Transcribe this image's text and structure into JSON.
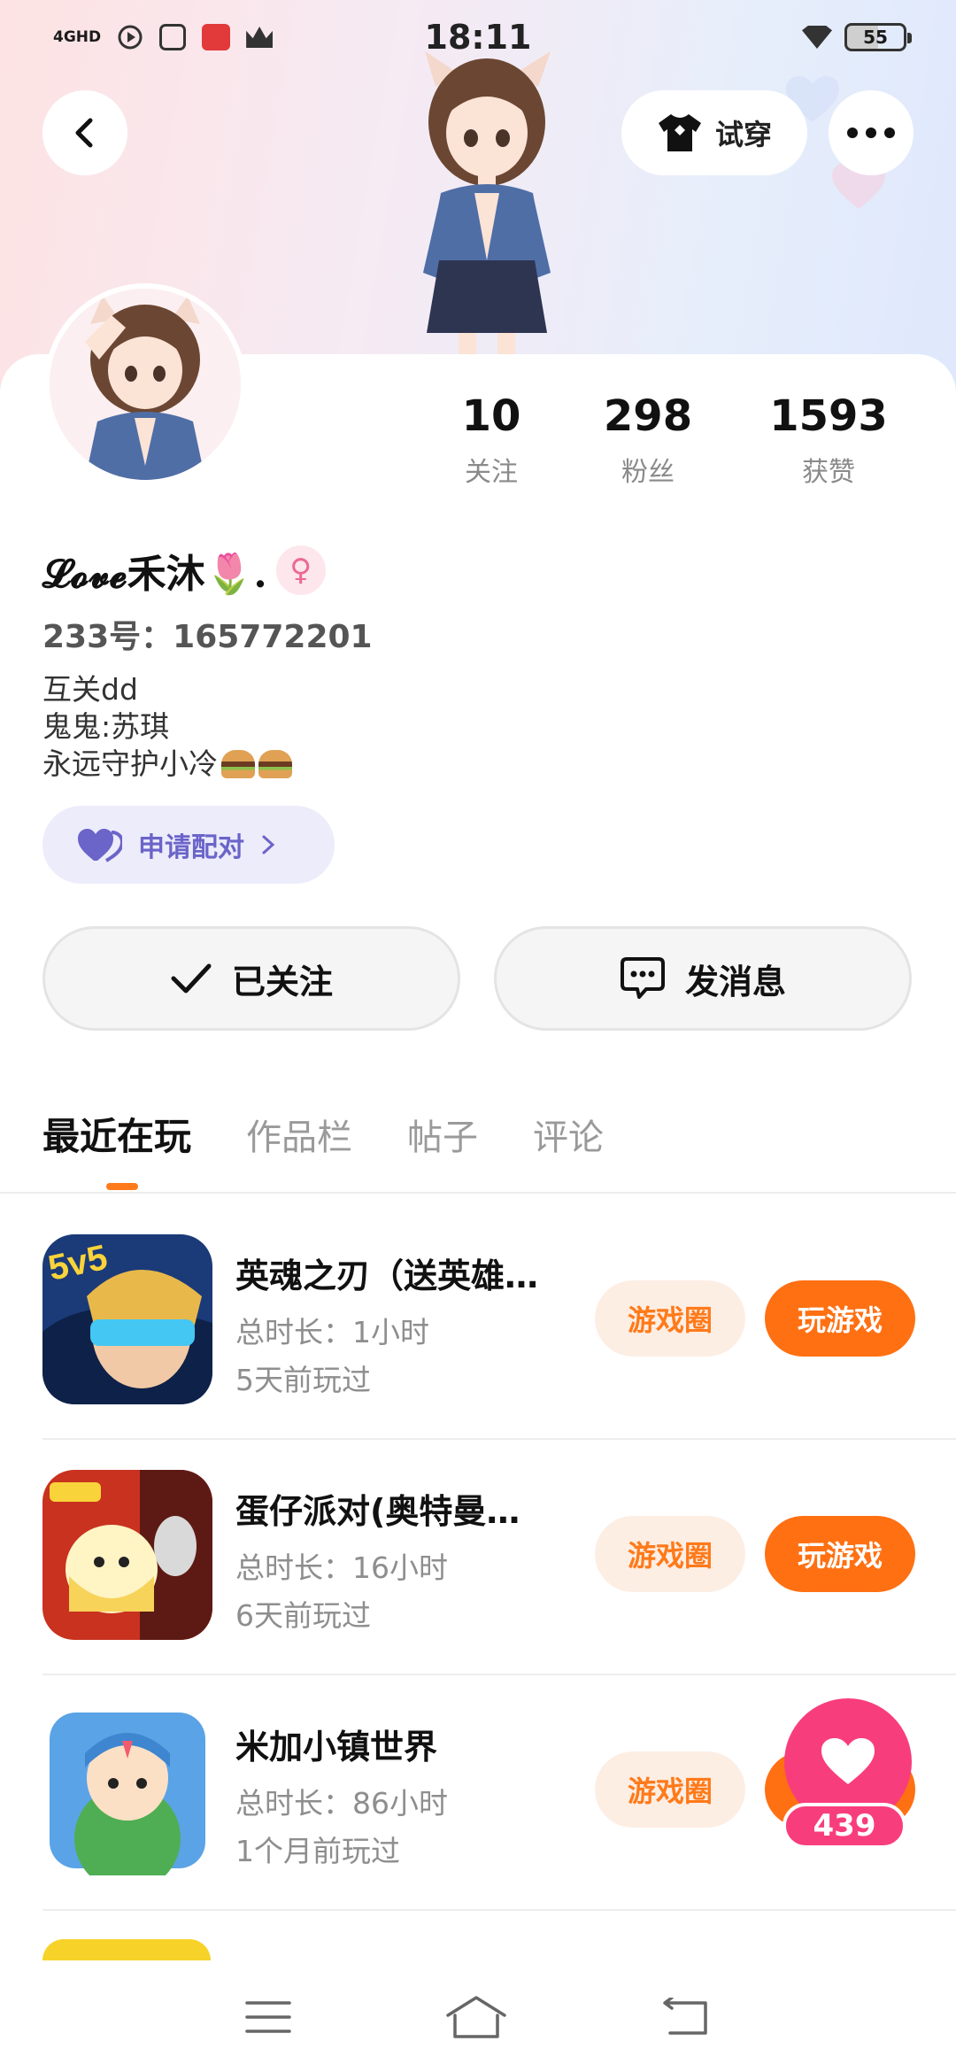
{
  "status_bar": {
    "network": "4GHD",
    "time": "18:11",
    "battery": "55"
  },
  "header": {
    "tryon_label": "试穿"
  },
  "profile": {
    "nickname": "𝓛𝓸𝓿𝓮禾沐🌷.",
    "gender_symbol": "♀",
    "uid": "233号：165772201",
    "bio_lines": [
      "互关dd",
      "鬼鬼:苏琪",
      "永远守护小冷"
    ],
    "pair_label": "申请配对",
    "stats": [
      {
        "value": "10",
        "label": "关注"
      },
      {
        "value": "298",
        "label": "粉丝"
      },
      {
        "value": "1593",
        "label": "获赞"
      }
    ]
  },
  "actions": {
    "follow_label": "已关注",
    "message_label": "发消息"
  },
  "tabs": [
    "最近在玩",
    "作品栏",
    "帖子",
    "评论"
  ],
  "games": [
    {
      "title": "英魂之刃（送英雄…",
      "duration": "总时长：1小时",
      "last_played": "5天前玩过",
      "circle_label": "游戏圈",
      "play_label": "玩游戏"
    },
    {
      "title": "蛋仔派对(奥特曼…",
      "duration": "总时长：16小时",
      "last_played": "6天前玩过",
      "circle_label": "游戏圈",
      "play_label": "玩游戏"
    },
    {
      "title": "米加小镇世界",
      "duration": "总时长：86小时",
      "last_played": "1个月前玩过",
      "circle_label": "游戏圈",
      "play_label": "玩游戏"
    }
  ],
  "like_float": {
    "count": "439"
  },
  "colors": {
    "accent_orange": "#ff7012",
    "pair_purple": "#6b64c9",
    "like_pink": "#f83d7d"
  },
  "icons": [
    "back-arrow-icon",
    "tshirt-icon",
    "more-dots-icon",
    "heart-icon",
    "checkmark-icon",
    "chat-bubble-icon",
    "chevron-right-icon",
    "menu-icon",
    "home-icon",
    "return-icon"
  ]
}
